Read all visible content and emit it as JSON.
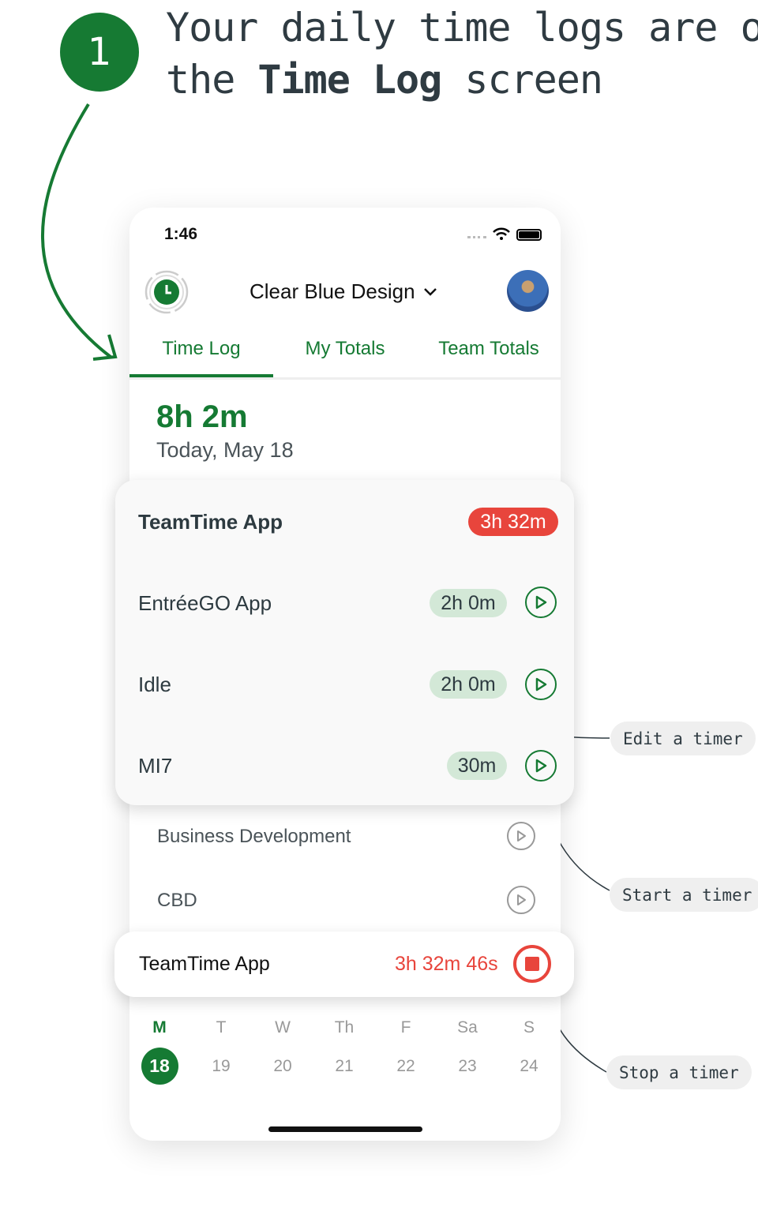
{
  "step_number": "1",
  "headline": {
    "line1": "Your daily time logs are on",
    "line2_prefix": "the ",
    "line2_bold": "Time Log",
    "line2_suffix": " screen"
  },
  "status_bar": {
    "time": "1:46"
  },
  "header": {
    "workspace": "Clear Blue Design"
  },
  "tabs": [
    {
      "label": "Time Log",
      "active": true
    },
    {
      "label": "My Totals"
    },
    {
      "label": "Team Totals"
    }
  ],
  "summary": {
    "total": "8h 2m",
    "date": "Today, May 18"
  },
  "active_projects": [
    {
      "name": "TeamTime App",
      "duration": "3h 32m",
      "running": true
    },
    {
      "name": "EntréeGO App",
      "duration": "2h 0m"
    },
    {
      "name": "Idle",
      "duration": "2h 0m"
    },
    {
      "name": "MI7",
      "duration": "30m"
    }
  ],
  "other_projects": [
    {
      "name": "Business Development"
    },
    {
      "name": "CBD"
    }
  ],
  "running_timer": {
    "name": "TeamTime App",
    "elapsed": "3h 32m 46s"
  },
  "week": {
    "days": [
      "M",
      "T",
      "W",
      "Th",
      "F",
      "Sa",
      "S"
    ],
    "dates": [
      "18",
      "19",
      "20",
      "21",
      "22",
      "23",
      "24"
    ],
    "selected_index": 0
  },
  "annotations": {
    "edit": "Edit a timer",
    "start": "Start a timer",
    "stop": "Stop a timer"
  },
  "colors": {
    "green": "#157a33",
    "red": "#e8453c",
    "badge_green": "#d3e8d7"
  }
}
